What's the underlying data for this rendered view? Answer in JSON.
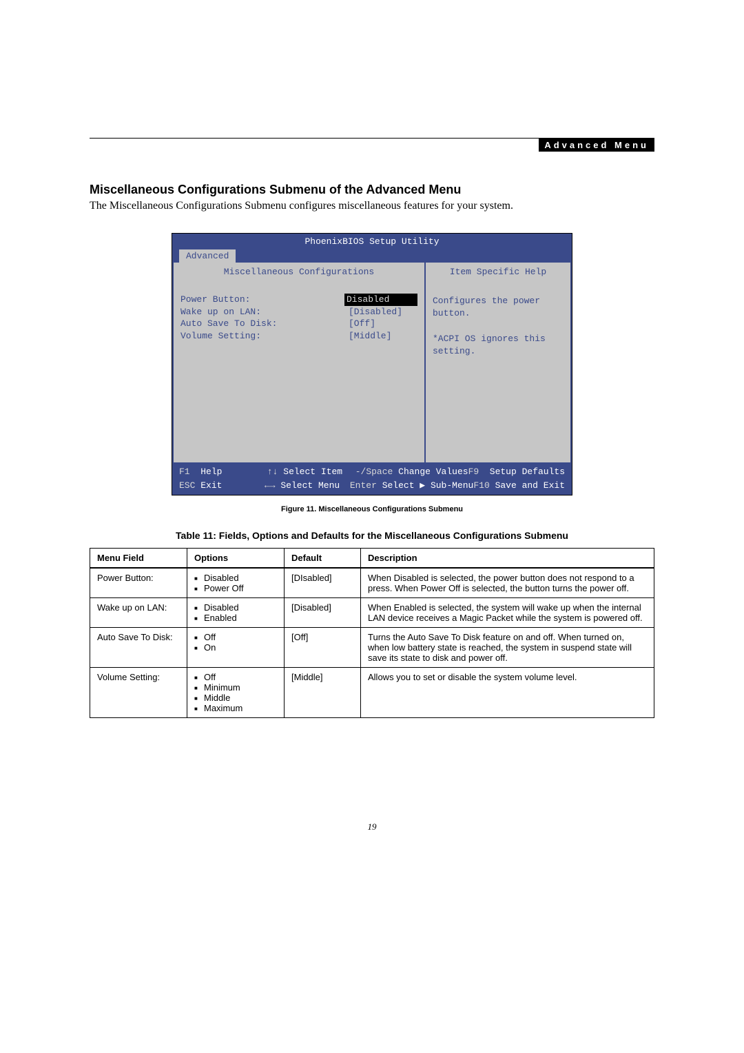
{
  "header": {
    "tab_label": "Advanced Menu"
  },
  "section": {
    "heading": "Miscellaneous Configurations Submenu of the Advanced Menu",
    "intro": "The Miscellaneous Configurations Submenu configures miscellaneous features for your system."
  },
  "bios": {
    "title": "PhoenixBIOS Setup Utility",
    "menu_selected": "Advanced",
    "left_header": "Miscellaneous Configurations",
    "right_header": "Item Specific Help",
    "settings": [
      {
        "label": "Power Button:",
        "value": "Disabled",
        "brackets": false,
        "highlight": true
      },
      {
        "label": "Wake up on LAN:",
        "value": "[Disabled]",
        "brackets": true,
        "highlight": false
      },
      {
        "label": "Auto Save To Disk:",
        "value": "[Off]",
        "brackets": true,
        "highlight": false
      },
      {
        "label": "Volume Setting:",
        "value": "[Middle]",
        "brackets": true,
        "highlight": false
      }
    ],
    "help_text_1": "Configures the power button.",
    "help_text_2": "*ACPI OS ignores this setting.",
    "keys": {
      "f1": "F1",
      "f1_lbl": "Help",
      "updown": "↑↓",
      "updown_lbl": "Select Item",
      "minus": "-/Space",
      "minus_lbl": "Change Values",
      "f9": "F9",
      "f9_lbl": "Setup Defaults",
      "esc": "ESC",
      "esc_lbl": "Exit",
      "lr": "←→",
      "lr_lbl": "Select Menu",
      "enter": "Enter",
      "enter_lbl": "Select ▶ Sub-Menu",
      "f10": "F10",
      "f10_lbl": "Save and Exit"
    }
  },
  "figure_caption": "Figure 11.   Miscellaneous Configurations Submenu",
  "table_caption": "Table 11: Fields, Options and Defaults for the Miscellaneous Configurations Submenu",
  "table": {
    "headers": {
      "field": "Menu Field",
      "options": "Options",
      "def": "Default",
      "desc": "Description"
    },
    "rows": [
      {
        "field": "Power Button:",
        "options": [
          "Disabled",
          "Power Off"
        ],
        "def": "[DIsabled]",
        "desc": "When Disabled is selected, the power button does not respond to a press. When Power Off is selected, the button turns the power off."
      },
      {
        "field": "Wake up on LAN:",
        "options": [
          "Disabled",
          "Enabled"
        ],
        "def": "[Disabled]",
        "desc": "When Enabled is selected, the system will wake up when the internal LAN device receives a Magic Packet while the system is powered off."
      },
      {
        "field": "Auto Save To Disk:",
        "options": [
          "Off",
          "On"
        ],
        "def": "[Off]",
        "desc": "Turns the Auto Save To Disk feature on and off. When turned on, when low battery state is reached, the system in suspend state will save its state to disk and power off."
      },
      {
        "field": "Volume Setting:",
        "options": [
          "Off",
          "Minimum",
          "Middle",
          "Maximum"
        ],
        "def": "[Middle]",
        "desc": "Allows you to set or disable the system volume level."
      }
    ]
  },
  "page_no": "19"
}
